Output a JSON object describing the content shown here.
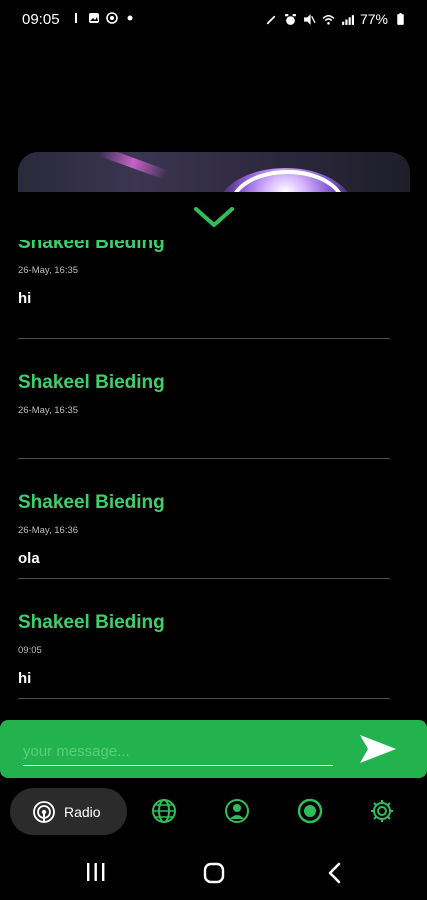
{
  "status_bar": {
    "time": "09:05",
    "battery": "77%"
  },
  "chat": {
    "messages": [
      {
        "sender": "Shakeel Bieding",
        "time": "26-May, 16:35",
        "text": "hi"
      },
      {
        "sender": "Shakeel Bieding",
        "time": "26-May, 16:35",
        "text": ""
      },
      {
        "sender": "Shakeel Bieding",
        "time": "26-May, 16:36",
        "text": "ola"
      },
      {
        "sender": "Shakeel Bieding",
        "time": "09:05",
        "text": "hi"
      }
    ]
  },
  "composer": {
    "placeholder": "your message..."
  },
  "nav": {
    "radio_label": "Radio"
  },
  "colors": {
    "accent_green": "#22b34e",
    "name_green": "#3bd06a",
    "background": "#000000"
  }
}
